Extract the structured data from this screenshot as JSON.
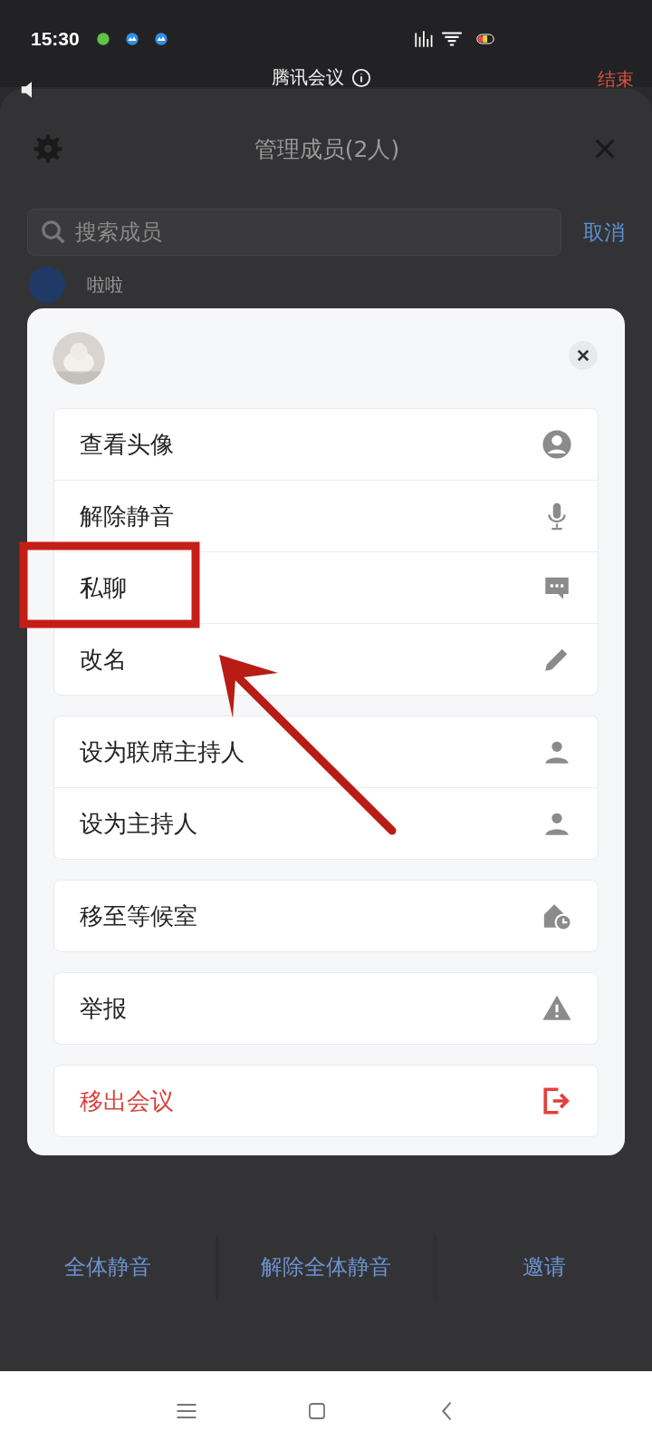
{
  "status_bar": {
    "time": "15:30"
  },
  "top_bar": {
    "title": "腾讯会议",
    "end": "结束"
  },
  "sheet": {
    "title": "管理成员(2人)",
    "search": {
      "placeholder": "搜索成员"
    },
    "cancel": "取消",
    "members": [
      {
        "name": "啦啦"
      }
    ],
    "actions": [
      "全体静音",
      "解除全体静音",
      "邀请"
    ]
  },
  "member_menu": {
    "groups": [
      [
        {
          "label": "查看头像",
          "danger": false
        },
        {
          "label": "解除静音",
          "danger": false
        },
        {
          "label": "私聊",
          "danger": false
        },
        {
          "label": "改名",
          "danger": false
        }
      ],
      [
        {
          "label": "设为联席主持人",
          "danger": false
        },
        {
          "label": "设为主持人",
          "danger": false
        }
      ],
      [
        {
          "label": "移至等候室",
          "danger": false
        }
      ],
      [
        {
          "label": "举报",
          "danger": false
        }
      ],
      [
        {
          "label": "移出会议",
          "danger": true
        }
      ]
    ]
  }
}
